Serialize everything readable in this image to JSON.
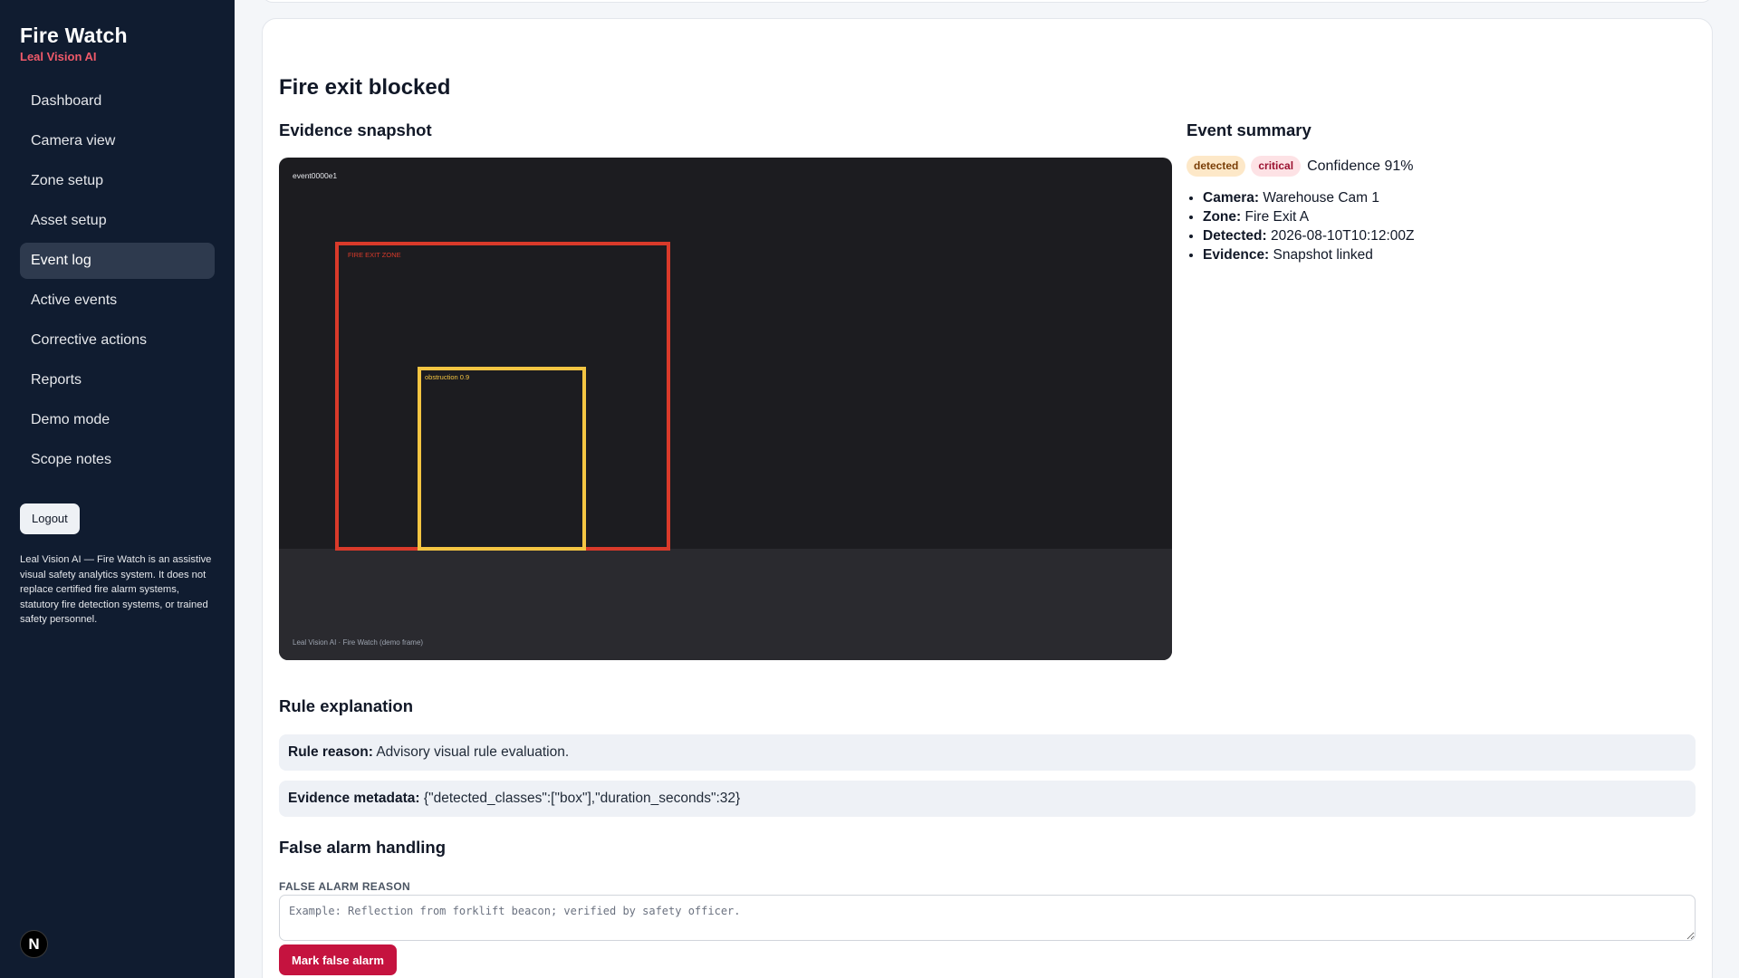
{
  "sidebar": {
    "brand_title": "Fire Watch",
    "brand_subtitle": "Leal Vision AI",
    "nav": [
      {
        "label": "Dashboard"
      },
      {
        "label": "Camera view"
      },
      {
        "label": "Zone setup"
      },
      {
        "label": "Asset setup"
      },
      {
        "label": "Event log",
        "active": true
      },
      {
        "label": "Active events"
      },
      {
        "label": "Corrective actions"
      },
      {
        "label": "Reports"
      },
      {
        "label": "Demo mode"
      },
      {
        "label": "Scope notes"
      }
    ],
    "logout_label": "Logout",
    "disclaimer": "Leal Vision AI — Fire Watch is an assistive visual safety analytics system. It does not replace certified fire alarm systems, statutory fire detection systems, or trained safety personnel.",
    "badge_letter": "N"
  },
  "main": {
    "title": "Fire exit blocked",
    "evidence": {
      "heading": "Evidence snapshot",
      "event_id": "event0000e1",
      "zone_label": "FIRE EXIT ZONE",
      "object_label": "obstruction 0.9",
      "footer": "Leal Vision AI · Fire Watch (demo frame)"
    },
    "summary": {
      "heading": "Event summary",
      "status_badge": "detected",
      "severity_badge": "critical",
      "confidence": "Confidence 91%",
      "camera_label": "Camera:",
      "camera_value": "Warehouse Cam 1",
      "zone_label": "Zone:",
      "zone_value": "Fire Exit A",
      "detected_label": "Detected:",
      "detected_value": "2026-08-10T10:12:00Z",
      "evidence_label": "Evidence:",
      "evidence_value": "Snapshot linked"
    },
    "rule": {
      "heading": "Rule explanation",
      "reason_label": "Rule reason:",
      "reason_value": "Advisory visual rule evaluation.",
      "metadata_label": "Evidence metadata:",
      "metadata_value": "{\"detected_classes\":[\"box\"],\"duration_seconds\":32}"
    },
    "false_alarm": {
      "heading": "False alarm handling",
      "field_label": "FALSE ALARM REASON",
      "placeholder": "Example: Reflection from forklift beacon; verified by safety officer.",
      "value": "",
      "button_label": "Mark false alarm"
    }
  },
  "colors": {
    "sidebar_bg": "#101c30",
    "brand_accent": "#f05a6a",
    "zone_box": "#d93a2a",
    "object_box": "#f4c542",
    "primary_button": "#c5133f"
  }
}
